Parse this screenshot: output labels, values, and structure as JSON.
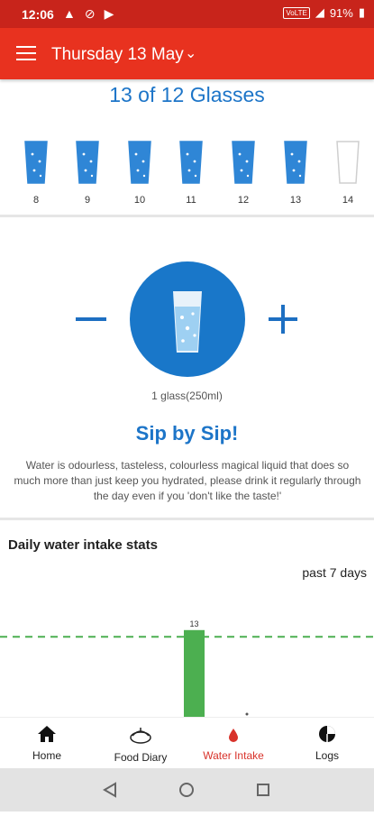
{
  "status_bar": {
    "time": "12:06",
    "network_label": "VoLTE",
    "battery": "91%"
  },
  "app_bar": {
    "date_title": "Thursday 13 May"
  },
  "summary": {
    "glass_count_text": "13 of 12 Glasses"
  },
  "glasses": [
    {
      "num": "8",
      "filled": true
    },
    {
      "num": "9",
      "filled": true
    },
    {
      "num": "10",
      "filled": true
    },
    {
      "num": "11",
      "filled": true
    },
    {
      "num": "12",
      "filled": true
    },
    {
      "num": "13",
      "filled": true
    },
    {
      "num": "14",
      "filled": false
    }
  ],
  "drink": {
    "glass_size": "1 glass(250ml)",
    "tagline": "Sip by Sip!",
    "description": "Water is odourless, tasteless, colourless magical liquid that does so much more than just keep you hydrated, please drink it regularly through the day even if you 'don't like the taste!'"
  },
  "stats": {
    "title": "Daily water intake stats",
    "range": "past 7 days"
  },
  "chart_data": {
    "type": "bar",
    "values": [
      13
    ],
    "data_labels": [
      "13"
    ],
    "reference_line": 12,
    "bar_color": "#4caf50",
    "line_color": "#4caf50"
  },
  "nav": {
    "items": [
      {
        "label": "Home",
        "icon": "home-icon"
      },
      {
        "label": "Food Diary",
        "icon": "food-diary-icon"
      },
      {
        "label": "Water Intake",
        "icon": "water-drop-icon",
        "active": true
      },
      {
        "label": "Logs",
        "icon": "pie-chart-icon"
      }
    ]
  },
  "colors": {
    "primary": "#e8321f",
    "accent": "#1d75c8",
    "chart": "#4caf50"
  }
}
